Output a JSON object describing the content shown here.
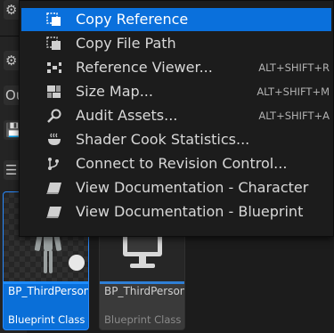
{
  "background": {
    "toolbar_glyphs": [
      "⚙",
      "⚙",
      "Ou",
      "💾 S",
      "☰"
    ],
    "tiles": [
      {
        "name": "BP_ThirdPersonCharacter",
        "type": "Blueprint Class",
        "selected": true
      },
      {
        "name": "BP_ThirdPersonGameMode",
        "type": "Blueprint Class",
        "selected": false
      }
    ]
  },
  "menu": {
    "items": [
      {
        "label": "Copy Reference",
        "shortcut": "",
        "icon": "copy-reference-icon",
        "highlighted": true
      },
      {
        "label": "Copy File Path",
        "shortcut": "",
        "icon": "copy-file-path-icon",
        "highlighted": false
      },
      {
        "label": "Reference Viewer...",
        "shortcut": "ALT+SHIFT+R",
        "icon": "reference-viewer-icon",
        "highlighted": false
      },
      {
        "label": "Size Map...",
        "shortcut": "ALT+SHIFT+M",
        "icon": "size-map-icon",
        "highlighted": false
      },
      {
        "label": "Audit Assets...",
        "shortcut": "ALT+SHIFT+A",
        "icon": "audit-assets-icon",
        "highlighted": false
      },
      {
        "label": "Shader Cook Statistics...",
        "shortcut": "",
        "icon": "shader-cook-icon",
        "highlighted": false
      },
      {
        "label": "Connect to Revision Control...",
        "shortcut": "",
        "icon": "revision-control-icon",
        "highlighted": false
      },
      {
        "label": "View Documentation - Character",
        "shortcut": "",
        "icon": "documentation-icon",
        "highlighted": false
      },
      {
        "label": "View Documentation - Blueprint",
        "shortcut": "",
        "icon": "documentation-icon",
        "highlighted": false
      }
    ]
  }
}
